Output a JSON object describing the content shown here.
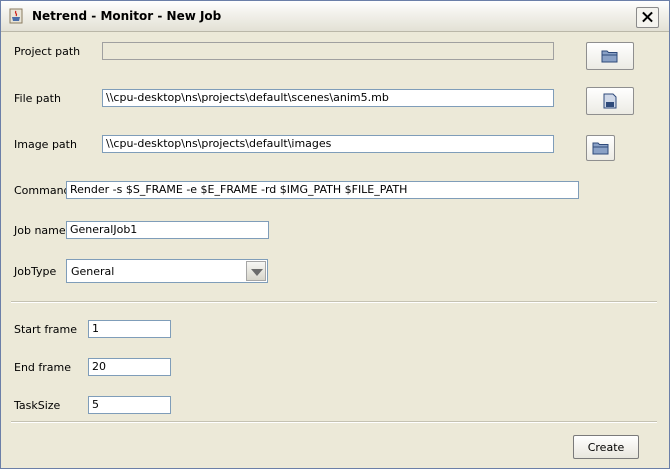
{
  "window": {
    "title": "Netrend - Monitor - New Job"
  },
  "icons": {
    "app": "java-cup-icon",
    "close": "close-icon",
    "folder": "folder-icon",
    "file": "file-icon"
  },
  "form": {
    "project_path": {
      "label": "Project path",
      "value": ""
    },
    "file_path": {
      "label": "File path",
      "value": "\\\\cpu-desktop\\ns\\projects\\default\\scenes\\anim5.mb"
    },
    "image_path": {
      "label": "Image path",
      "value": "\\\\cpu-desktop\\ns\\projects\\default\\images"
    },
    "command": {
      "label": "Command",
      "value": "Render -s $S_FRAME -e $E_FRAME -rd $IMG_PATH $FILE_PATH"
    },
    "job_name": {
      "label": "Job name",
      "value": "GeneralJob1"
    },
    "job_type": {
      "label": "JobType",
      "value": "General"
    },
    "start_frame": {
      "label": "Start frame",
      "value": "1"
    },
    "end_frame": {
      "label": "End frame",
      "value": "20"
    },
    "task_size": {
      "label": "TaskSize",
      "value": "5"
    }
  },
  "buttons": {
    "create": "Create"
  }
}
